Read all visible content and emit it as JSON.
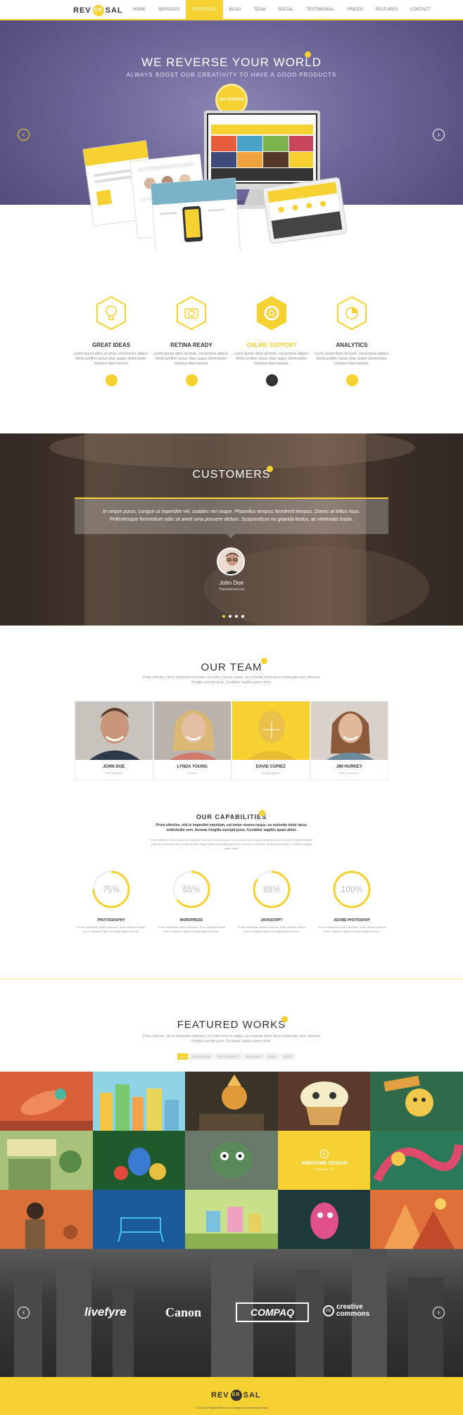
{
  "brand": {
    "logo_left": "REV",
    "logo_mid": "ER",
    "logo_right": "SAL"
  },
  "nav": {
    "items": [
      "HOME",
      "SERVICES",
      "PORTFOLIO",
      "BLOG",
      "TEAM",
      "SOCIAL",
      "TESTIMONIAL",
      "PRICES",
      "FEATURES",
      "CONTACT"
    ],
    "active": "PORTFOLIO"
  },
  "hero": {
    "title": "WE REVERSE YOUR WORLD",
    "subtitle": "ALWAYS BOOST OUR CREATIVITY TO HAVE A GOOD PRODUCTS",
    "cta": "GET STARTED",
    "prev": "‹",
    "next": "›"
  },
  "features": [
    {
      "icon": "lightbulb-icon",
      "title": "GREAT IDEAS",
      "text": "Lorem ipsum dolor sit amet, consectetur adipisc. Morbi porttitor luctus vitae augue ullamcorper. Vivamus diam laoreet."
    },
    {
      "icon": "camera-icon",
      "title": "RETINA READY",
      "text": "Lorem ipsum dolor sit amet, consectetur adipisc. Morbi porttitor luctus vitae augue ullamcorper. Vivamus diam laoreet."
    },
    {
      "icon": "lifebuoy-icon",
      "title": "ONLINE SUPPORT",
      "text": "Lorem ipsum dolor sit amet, consectetur adipisc. Morbi porttitor luctus vitae augue ullamcorper. Vivamus diam laoreet."
    },
    {
      "icon": "pie-chart-icon",
      "title": "ANALYTICS",
      "text": "Lorem ipsum dolor sit amet, consectetur adipisc. Morbi porttitor luctus vitae augue ullamcorper. Vivamus diam laoreet."
    }
  ],
  "customers": {
    "title": "CUSTOMERS",
    "quote": "In neque purus, congue ut imperdiet vel, sodales vel neque. Phasellus tempus hendrerit tempus. Donec at tellus risus. Pellentesque fermentum odio sit amet urna posuere dictum. Suspendisse eu gravida lectus, ac venenatis turpis.",
    "name": "John Doe",
    "site": "Themeforest.net"
  },
  "team": {
    "title": "OUR TEAM",
    "subtitle": "Proin ultricies, nisl in imperdiet interdum, est tortor viverra neque, eu molestie dolor lacus sollicitudin sem. Aenean fringilla suscipit justo. Curabitur sagittis quam dolor.",
    "members": [
      {
        "name": "JOHN DOE",
        "role": "Web Designer"
      },
      {
        "name": "LYNDA YOUNG",
        "role": "Founder"
      },
      {
        "name": "DAVID COPIEZ",
        "role": "Photographers"
      },
      {
        "name": "JIM HURKEY",
        "role": "Web Developer"
      }
    ]
  },
  "capabilities": {
    "title": "OUR CAPABILITIES",
    "lead": "Proin ultricies, nisl in imperdiet interdum, est tortor viverra neque, eu molestie dolor lacus sollicitudin sem. Aenean fringilla suscipit justo. Curabitur sagittis quam dolor.",
    "text": "Proin ultricies, nisl in imperdiet interdum, est tortor viverra neque, eu molestie dolor lacus sollicitudin sem. Aenean fringilla suscipit justo eu commodo nunc pharetra erat. Suspendisse pellentesque purus quis libero pharetra, at lacinia mi mollis. Curabitur sagittis quam dolor.",
    "skills": [
      {
        "label": "75%",
        "value": 75,
        "name": "PHOTOGRAPHY",
        "text": "In hac habitasse platea dictumst. Nunc ultricies lacinia lorem. Aliquam eget eros eget sapien dictum."
      },
      {
        "label": "65%",
        "value": 65,
        "name": "WORDPRESS",
        "text": "In hac habitasse platea dictumst. Nunc ultricies lacinia lorem. Aliquam eget eros eget sapien dictum."
      },
      {
        "label": "85%",
        "value": 85,
        "name": "JAVASCRIPT",
        "text": "In hac habitasse platea dictumst. Nunc ultricies lacinia lorem. Aliquam eget eros eget sapien dictum."
      },
      {
        "label": "100%",
        "value": 100,
        "name": "ADOBE PHOTOSHOP",
        "text": "In hac habitasse platea dictumst. Nunc ultricies lacinia lorem. Aliquam eget eros eget sapien dictum."
      }
    ]
  },
  "works": {
    "title": "FEATURED WORKS",
    "subtitle": "Proin ultricies, nisl in imperdiet interdum, est tortor viverra neque, eu molestie dolor lacus sollicitudin sem. Aenean fringilla suscipit justo. Curabitur sagittis quam dolor.",
    "filters": [
      "ALL",
      "WEB DESIGN",
      "PHOTOGRAPHY",
      "BRANDING",
      "PRINT",
      "VIDEO"
    ],
    "highlight_title": "AWESOME DESIGN",
    "highlight_sub": "Illustration, Art"
  },
  "clients": [
    "livefyre",
    "Canon",
    "COMPAQ",
    "creative commons"
  ],
  "footer": {
    "copyright": "© 2013 All Rights Reserved. Designed by Ivanmarah Kaar"
  },
  "colors": {
    "accent": "#f5d131",
    "dark": "#333333"
  }
}
